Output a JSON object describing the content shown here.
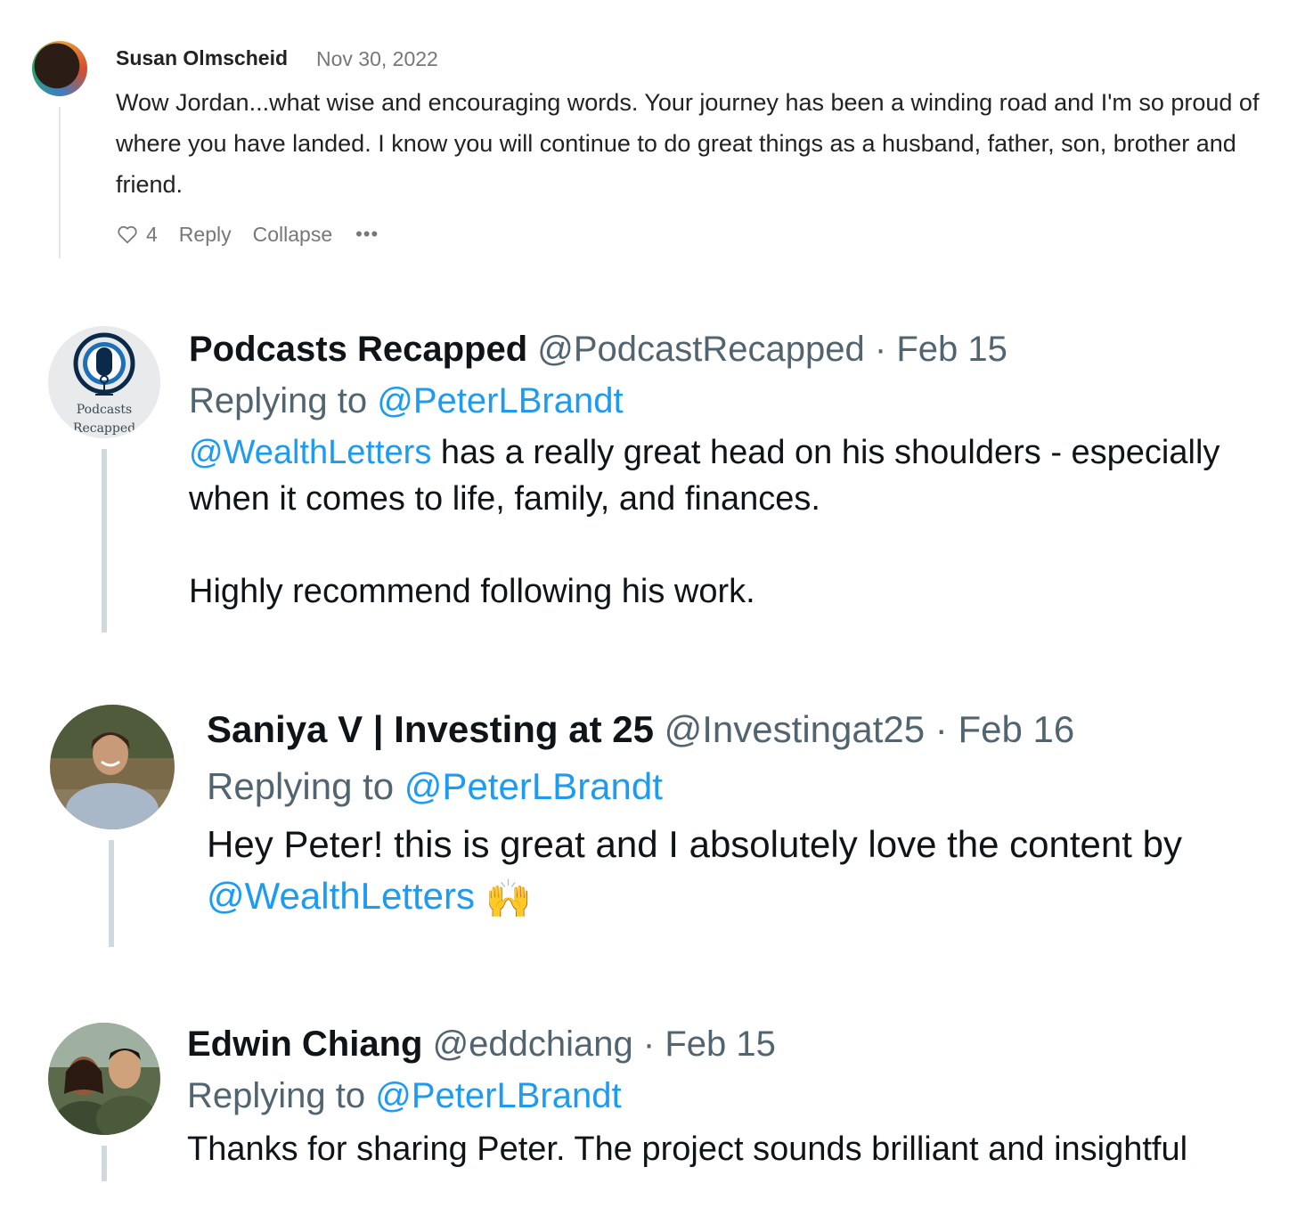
{
  "comment": {
    "author": "Susan Olmscheid",
    "date": "Nov 30, 2022",
    "body": "Wow Jordan...what wise and encouraging words. Your journey has been a winding road and I'm so proud of where you have landed. I know you will continue to do great things as a husband, father, son, brother and friend.",
    "likes": "4",
    "reply_label": "Reply",
    "collapse_label": "Collapse",
    "more_label": "•••",
    "heart_icon": "heart-icon"
  },
  "tweets": [
    {
      "name": "Podcasts Recapped",
      "handle": "@PodcastRecapped",
      "separator": "·",
      "date": "Feb 15",
      "replying_prefix": "Replying to",
      "replying_to": "@PeterLBrandt",
      "mention": "@WealthLetters",
      "line1_rest": " has a really great head on his shoulders - especially",
      "line2": "when it comes to life, family, and finances.",
      "line3": "Highly recommend following his work.",
      "avatar_text_1": "Podcasts",
      "avatar_text_2": "Recapped"
    },
    {
      "name": "Saniya V | Investing at 25",
      "handle": "@Investingat25",
      "separator": "·",
      "date": "Feb 16",
      "replying_prefix": "Replying to",
      "replying_to": "@PeterLBrandt",
      "line1": "Hey Peter! this is great and I absolutely love the content by",
      "mention": "@WealthLetters",
      "emoji": "🙌"
    },
    {
      "name": "Edwin Chiang",
      "handle": "@eddchiang",
      "separator": "·",
      "date": "Feb 15",
      "replying_prefix": "Replying to",
      "replying_to": "@PeterLBrandt",
      "line1": "Thanks for sharing Peter. The project sounds brilliant and insightful"
    }
  ]
}
